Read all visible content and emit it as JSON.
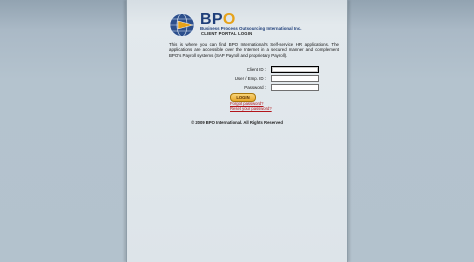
{
  "brand": {
    "name_prefix": "BP",
    "name_suffix": "O",
    "full_name": "Business Process Outsourcing International Inc.",
    "portal_label": "CLIENT PORTAL LOGIN"
  },
  "intro_text": "This is where you can find BPO International's Self-service HR applications. The applications are accessible over the Internet in a secured manner and complement BPO's Payroll systems (SAP Payroll and proprietary Payroll).",
  "form": {
    "client_id_label": "Client ID :",
    "user_id_label": "User / Emp. ID :",
    "password_label": "Password :",
    "client_id_value": "",
    "user_id_value": "",
    "password_value": "",
    "login_label": "LOGIN"
  },
  "links": {
    "forgot_password": "Forgot password?",
    "reset_password": "Reset your password?"
  },
  "footer": {
    "copyright": "© 2009 BPO International. All Rights Reserved"
  },
  "colors": {
    "brand_blue": "#1f3f7a",
    "brand_orange": "#e6a21a",
    "link_red": "#b3151b",
    "background": "#b3c2cd"
  }
}
